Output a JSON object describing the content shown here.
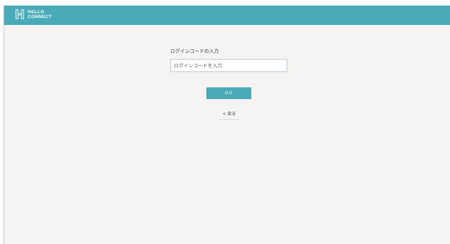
{
  "header": {
    "logo_line1": "HELLO",
    "logo_line2": "CONNECT",
    "logo_icon": "h-logo-icon",
    "bg_color": "#49aab8"
  },
  "form": {
    "label": "ログインコードの入力",
    "input_placeholder": "ログインコードを入力",
    "input_value": "",
    "go_label": "GO",
    "back_label": "< 戻る"
  },
  "colors": {
    "accent": "#49aab8",
    "background": "#f5f4f2"
  }
}
